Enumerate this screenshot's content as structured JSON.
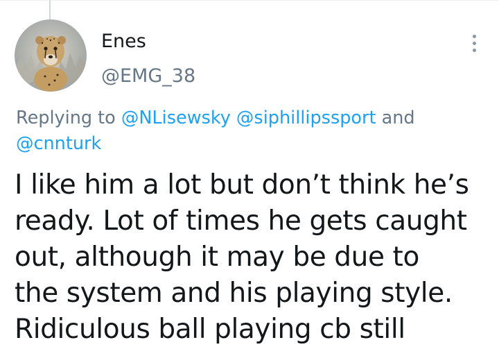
{
  "author": {
    "display_name": "Enes",
    "handle": "@EMG_38",
    "avatar_icon": "cheetah-avatar"
  },
  "reply": {
    "prefix": "Replying to",
    "mentions": [
      "@NLisewsky",
      "@siphillipssport",
      "@cnnturk"
    ],
    "conjunction": "and"
  },
  "tweet": {
    "lines": [
      "I like him a lot but don’t think he’s",
      "ready. Lot of times he gets caught",
      "out, although it may be due to",
      "the system and his playing style.",
      "Ridiculous ball playing cb still"
    ]
  },
  "colors": {
    "link": "#1da1f2",
    "secondary_text": "#657786",
    "primary_text": "#14171a",
    "thread_line": "#cfd9de"
  }
}
